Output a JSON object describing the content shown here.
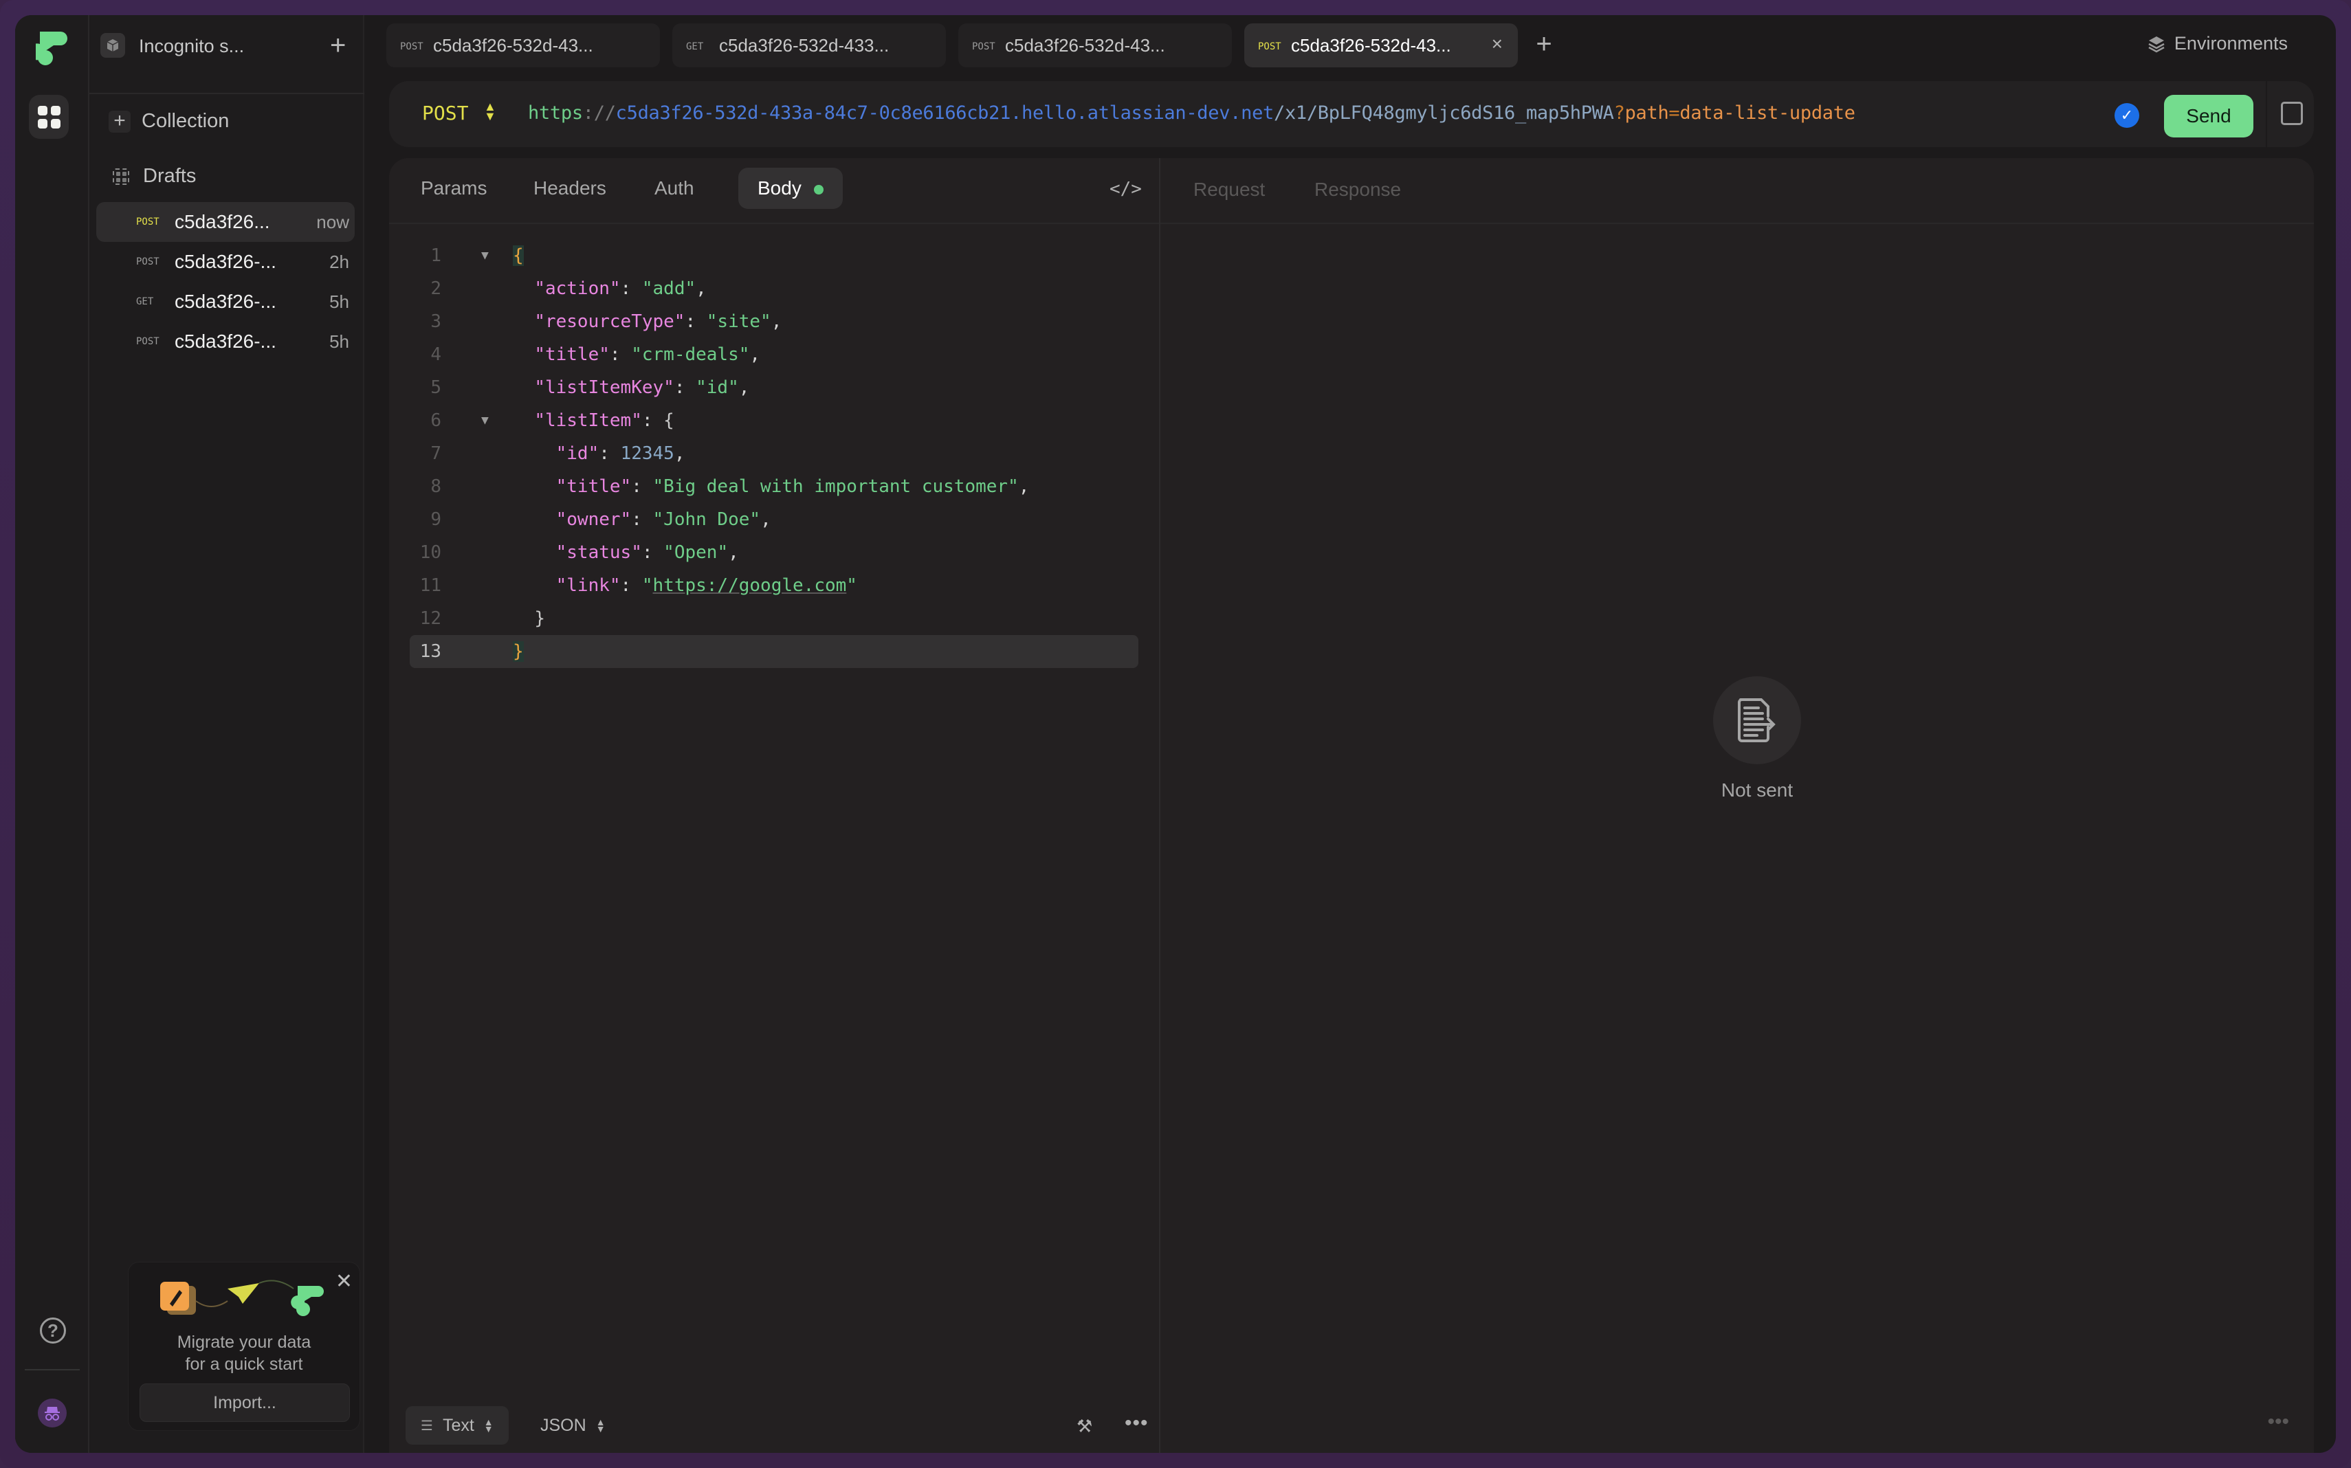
{
  "workspace": {
    "name": "Incognito s...",
    "add_label": "+"
  },
  "sidebar": {
    "collection_label": "Collection",
    "drafts_label": "Drafts",
    "drafts": [
      {
        "method": "POST",
        "name": "c5da3f26...",
        "time": "now",
        "active": true
      },
      {
        "method": "POST",
        "name": "c5da3f26-...",
        "time": "2h",
        "active": false
      },
      {
        "method": "GET",
        "name": "c5da3f26-...",
        "time": "5h",
        "active": false
      },
      {
        "method": "POST",
        "name": "c5da3f26-...",
        "time": "5h",
        "active": false
      }
    ],
    "promo": {
      "line1": "Migrate your data",
      "line2": "for a quick start",
      "button": "Import..."
    }
  },
  "tabs": [
    {
      "method": "POST",
      "name": "c5da3f26-532d-43..."
    },
    {
      "method": "GET",
      "name": "c5da3f26-532d-433..."
    },
    {
      "method": "POST",
      "name": "c5da3f26-532d-43..."
    },
    {
      "method": "POST",
      "name": "c5da3f26-532d-43...",
      "active": true
    }
  ],
  "environments_label": "Environments",
  "request": {
    "method": "POST",
    "url": {
      "scheme": "https",
      "sep": "://",
      "host": "c5da3f26-532d-433a-84c7-0c8e6166cb21.hello.atlassian-dev.net",
      "path": "/x1/BpLFQ48gmyljc6dS16_map5hPWA",
      "q": "?",
      "key": "path",
      "eq": "=",
      "value": "data-list-update"
    },
    "send_label": "Send"
  },
  "panel_tabs": {
    "params": "Params",
    "headers": "Headers",
    "auth": "Auth",
    "body": "Body",
    "code_icon": "</>"
  },
  "response_tabs": {
    "request": "Request",
    "response": "Response"
  },
  "body_lines": {
    "l1": "{",
    "l2k": "\"action\"",
    "l2v": "\"add\"",
    "l3k": "\"resourceType\"",
    "l3v": "\"site\"",
    "l4k": "\"title\"",
    "l4v": "\"crm-deals\"",
    "l5k": "\"listItemKey\"",
    "l5v": "\"id\"",
    "l6k": "\"listItem\"",
    "l6v": "{",
    "l7k": "\"id\"",
    "l7v": "12345",
    "l8k": "\"title\"",
    "l8v": "\"Big deal with important customer\"",
    "l9k": "\"owner\"",
    "l9v": "\"John Doe\"",
    "l10k": "\"status\"",
    "l10v": "\"Open\"",
    "l11k": "\"link\"",
    "l11q": "\"",
    "l11v": "https://google.com",
    "l12": "}",
    "l13": "}"
  },
  "line_numbers": [
    "1",
    "2",
    "3",
    "4",
    "5",
    "6",
    "7",
    "8",
    "9",
    "10",
    "11",
    "12",
    "13"
  ],
  "response_empty": "Not sent",
  "footer": {
    "mode": "Text",
    "format": "JSON"
  },
  "colors": {
    "send": "#74dc8e",
    "post": "#e2df4a",
    "body_dot": "#5dcc7e",
    "check": "#1c6fe8"
  }
}
